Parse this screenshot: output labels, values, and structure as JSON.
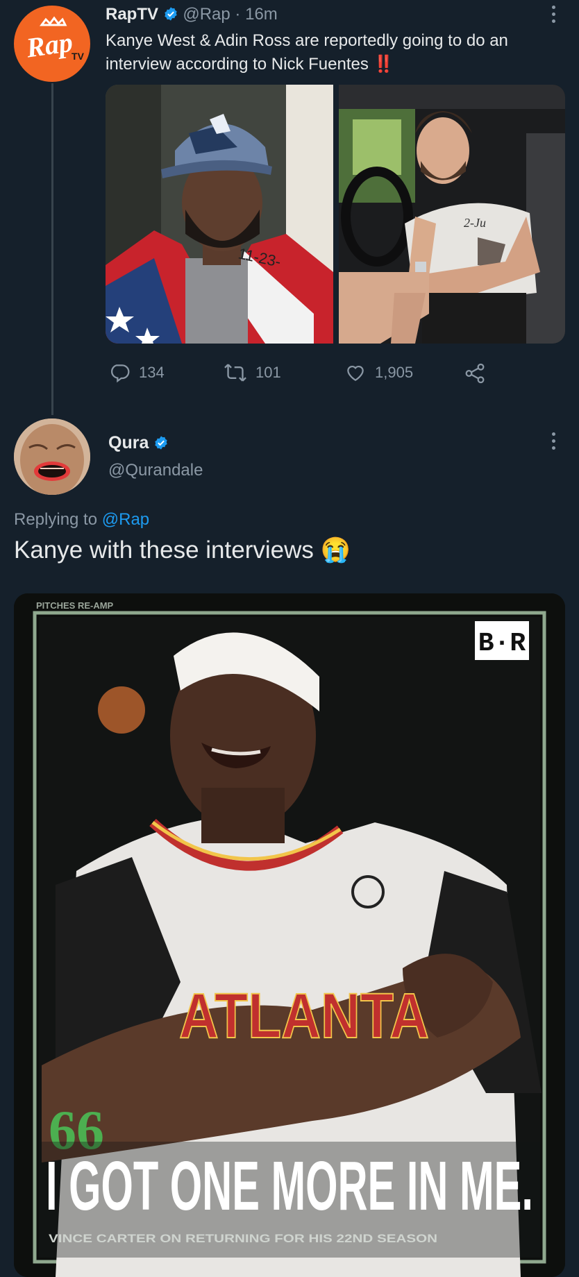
{
  "tweet1": {
    "author": "RapTV",
    "handle": "@Rap",
    "separator": "·",
    "time": "16m",
    "avatar_text": "Rap",
    "avatar_sub": "TV",
    "text": "Kanye West & Adin Ross are reportedly going to do an interview according to Nick Fuentes",
    "emoji": "‼️",
    "photo1": {
      "cap_text": "11-23-"
    },
    "photo2": {
      "shirt_text": "2-Ju"
    },
    "replies": "134",
    "retweets": "101",
    "likes": "1,905"
  },
  "tweet2": {
    "author": "Qura",
    "handle": "@Qurandale",
    "replying_prefix": "Replying to",
    "replying_to": "@Rap",
    "text": "Kanye with these interviews",
    "emoji": "😭"
  },
  "meme": {
    "top_text": "PITCHES RE-AMP",
    "badge": "B·R",
    "jersey": "ATLANTA",
    "quote_mark": "66",
    "headline": "I GOT ONE MORE IN ME.",
    "caption": "VINCE CARTER ON RETURNING FOR HIS 22ND SEASON"
  },
  "colors": {
    "background": "#15202b",
    "accent": "#1d9bf0",
    "avatar_orange": "#f26522"
  }
}
